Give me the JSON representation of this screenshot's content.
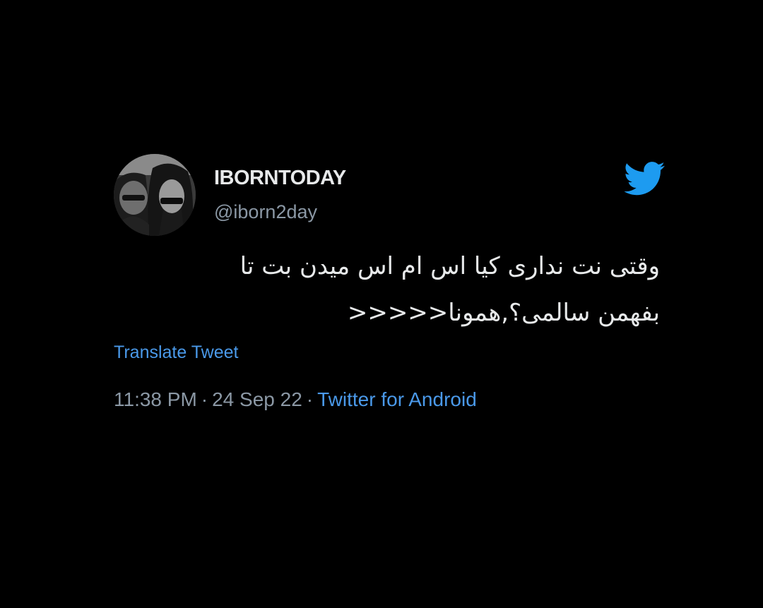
{
  "tweet": {
    "display_name": "IBORNTODAY",
    "handle": "@iborn2day",
    "text_line1": "وقتی نت نداری کیا اس ام اس میدن بت تا",
    "text_line2": "بفهمن سالمی؟,همونا<<<<<",
    "translate_label": "Translate Tweet",
    "time": "11:38 PM",
    "separator": "·",
    "date": "24 Sep 22",
    "source": "Twitter for Android"
  },
  "icons": {
    "brand": "twitter-bird-icon",
    "avatar": "profile-avatar"
  },
  "colors": {
    "background": "#000000",
    "primary_text": "#e7e9ea",
    "secondary_text": "#8b98a5",
    "link": "#4a99e9",
    "twitter_blue": "#1d9bf0"
  }
}
